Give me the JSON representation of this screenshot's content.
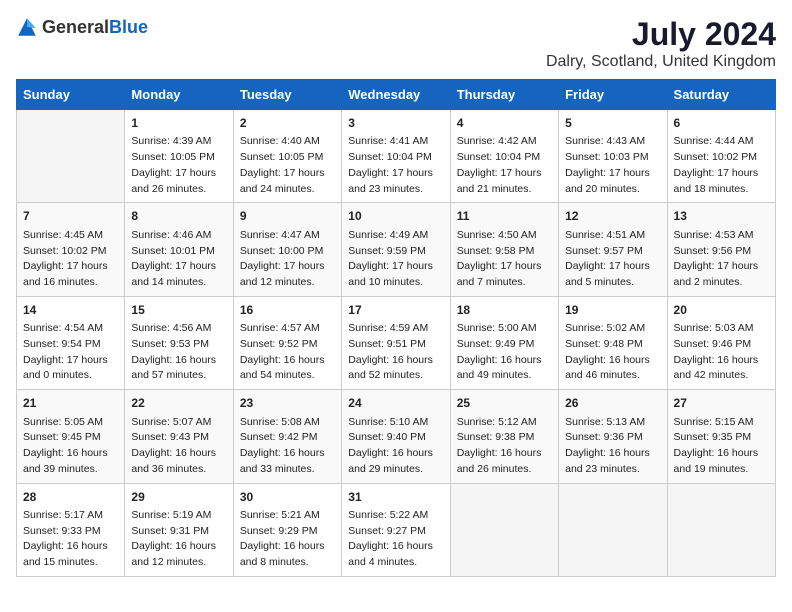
{
  "logo": {
    "general": "General",
    "blue": "Blue"
  },
  "title": "July 2024",
  "location": "Dalry, Scotland, United Kingdom",
  "headers": [
    "Sunday",
    "Monday",
    "Tuesday",
    "Wednesday",
    "Thursday",
    "Friday",
    "Saturday"
  ],
  "weeks": [
    [
      {
        "day": "",
        "content": ""
      },
      {
        "day": "1",
        "content": "Sunrise: 4:39 AM\nSunset: 10:05 PM\nDaylight: 17 hours\nand 26 minutes."
      },
      {
        "day": "2",
        "content": "Sunrise: 4:40 AM\nSunset: 10:05 PM\nDaylight: 17 hours\nand 24 minutes."
      },
      {
        "day": "3",
        "content": "Sunrise: 4:41 AM\nSunset: 10:04 PM\nDaylight: 17 hours\nand 23 minutes."
      },
      {
        "day": "4",
        "content": "Sunrise: 4:42 AM\nSunset: 10:04 PM\nDaylight: 17 hours\nand 21 minutes."
      },
      {
        "day": "5",
        "content": "Sunrise: 4:43 AM\nSunset: 10:03 PM\nDaylight: 17 hours\nand 20 minutes."
      },
      {
        "day": "6",
        "content": "Sunrise: 4:44 AM\nSunset: 10:02 PM\nDaylight: 17 hours\nand 18 minutes."
      }
    ],
    [
      {
        "day": "7",
        "content": "Sunrise: 4:45 AM\nSunset: 10:02 PM\nDaylight: 17 hours\nand 16 minutes."
      },
      {
        "day": "8",
        "content": "Sunrise: 4:46 AM\nSunset: 10:01 PM\nDaylight: 17 hours\nand 14 minutes."
      },
      {
        "day": "9",
        "content": "Sunrise: 4:47 AM\nSunset: 10:00 PM\nDaylight: 17 hours\nand 12 minutes."
      },
      {
        "day": "10",
        "content": "Sunrise: 4:49 AM\nSunset: 9:59 PM\nDaylight: 17 hours\nand 10 minutes."
      },
      {
        "day": "11",
        "content": "Sunrise: 4:50 AM\nSunset: 9:58 PM\nDaylight: 17 hours\nand 7 minutes."
      },
      {
        "day": "12",
        "content": "Sunrise: 4:51 AM\nSunset: 9:57 PM\nDaylight: 17 hours\nand 5 minutes."
      },
      {
        "day": "13",
        "content": "Sunrise: 4:53 AM\nSunset: 9:56 PM\nDaylight: 17 hours\nand 2 minutes."
      }
    ],
    [
      {
        "day": "14",
        "content": "Sunrise: 4:54 AM\nSunset: 9:54 PM\nDaylight: 17 hours\nand 0 minutes."
      },
      {
        "day": "15",
        "content": "Sunrise: 4:56 AM\nSunset: 9:53 PM\nDaylight: 16 hours\nand 57 minutes."
      },
      {
        "day": "16",
        "content": "Sunrise: 4:57 AM\nSunset: 9:52 PM\nDaylight: 16 hours\nand 54 minutes."
      },
      {
        "day": "17",
        "content": "Sunrise: 4:59 AM\nSunset: 9:51 PM\nDaylight: 16 hours\nand 52 minutes."
      },
      {
        "day": "18",
        "content": "Sunrise: 5:00 AM\nSunset: 9:49 PM\nDaylight: 16 hours\nand 49 minutes."
      },
      {
        "day": "19",
        "content": "Sunrise: 5:02 AM\nSunset: 9:48 PM\nDaylight: 16 hours\nand 46 minutes."
      },
      {
        "day": "20",
        "content": "Sunrise: 5:03 AM\nSunset: 9:46 PM\nDaylight: 16 hours\nand 42 minutes."
      }
    ],
    [
      {
        "day": "21",
        "content": "Sunrise: 5:05 AM\nSunset: 9:45 PM\nDaylight: 16 hours\nand 39 minutes."
      },
      {
        "day": "22",
        "content": "Sunrise: 5:07 AM\nSunset: 9:43 PM\nDaylight: 16 hours\nand 36 minutes."
      },
      {
        "day": "23",
        "content": "Sunrise: 5:08 AM\nSunset: 9:42 PM\nDaylight: 16 hours\nand 33 minutes."
      },
      {
        "day": "24",
        "content": "Sunrise: 5:10 AM\nSunset: 9:40 PM\nDaylight: 16 hours\nand 29 minutes."
      },
      {
        "day": "25",
        "content": "Sunrise: 5:12 AM\nSunset: 9:38 PM\nDaylight: 16 hours\nand 26 minutes."
      },
      {
        "day": "26",
        "content": "Sunrise: 5:13 AM\nSunset: 9:36 PM\nDaylight: 16 hours\nand 23 minutes."
      },
      {
        "day": "27",
        "content": "Sunrise: 5:15 AM\nSunset: 9:35 PM\nDaylight: 16 hours\nand 19 minutes."
      }
    ],
    [
      {
        "day": "28",
        "content": "Sunrise: 5:17 AM\nSunset: 9:33 PM\nDaylight: 16 hours\nand 15 minutes."
      },
      {
        "day": "29",
        "content": "Sunrise: 5:19 AM\nSunset: 9:31 PM\nDaylight: 16 hours\nand 12 minutes."
      },
      {
        "day": "30",
        "content": "Sunrise: 5:21 AM\nSunset: 9:29 PM\nDaylight: 16 hours\nand 8 minutes."
      },
      {
        "day": "31",
        "content": "Sunrise: 5:22 AM\nSunset: 9:27 PM\nDaylight: 16 hours\nand 4 minutes."
      },
      {
        "day": "",
        "content": ""
      },
      {
        "day": "",
        "content": ""
      },
      {
        "day": "",
        "content": ""
      }
    ]
  ]
}
